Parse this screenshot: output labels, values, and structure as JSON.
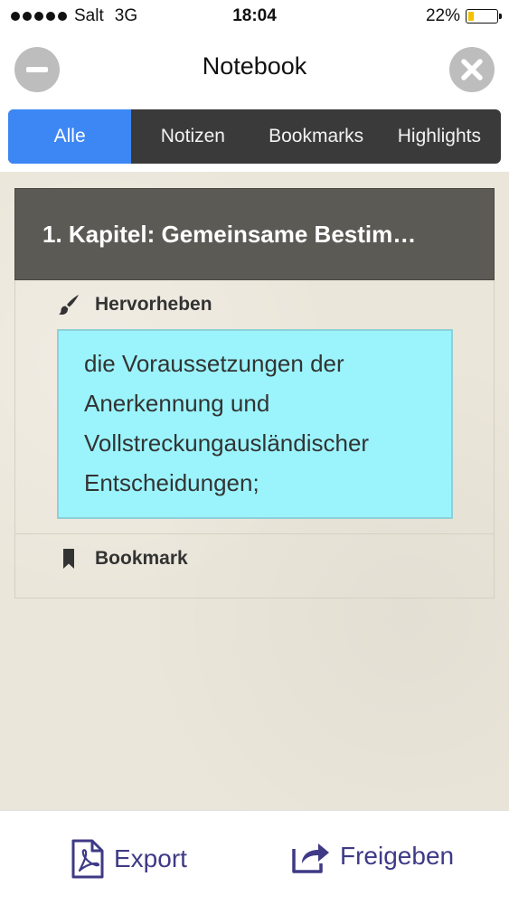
{
  "status_bar": {
    "carrier": "Salt",
    "network": "3G",
    "time": "18:04",
    "battery": "22%",
    "battery_level": 0.22
  },
  "nav": {
    "title": "Notebook"
  },
  "tabs": [
    {
      "label": "Alle",
      "active": true
    },
    {
      "label": "Notizen",
      "active": false
    },
    {
      "label": "Bookmarks",
      "active": false
    },
    {
      "label": "Highlights",
      "active": false
    }
  ],
  "chapter": {
    "title": "1. Kapitel: Gemeinsame Bestim…",
    "entries": [
      {
        "type_label": "Hervorheben",
        "icon": "brush-icon",
        "lines": [
          "die Voraussetzungen der",
          "Anerkennung und",
          "Vollstreckungausländischer",
          "Entscheidungen;"
        ]
      },
      {
        "type_label": "Bookmark",
        "icon": "bookmark-icon"
      }
    ]
  },
  "bottom": {
    "export_label": "Export",
    "share_label": "Freigeben"
  },
  "colors": {
    "accent": "#3d87f5",
    "highlight": "#9bf4fc",
    "action": "#3e3a86",
    "header": "#5c5a55",
    "battery": "#f2c200"
  }
}
